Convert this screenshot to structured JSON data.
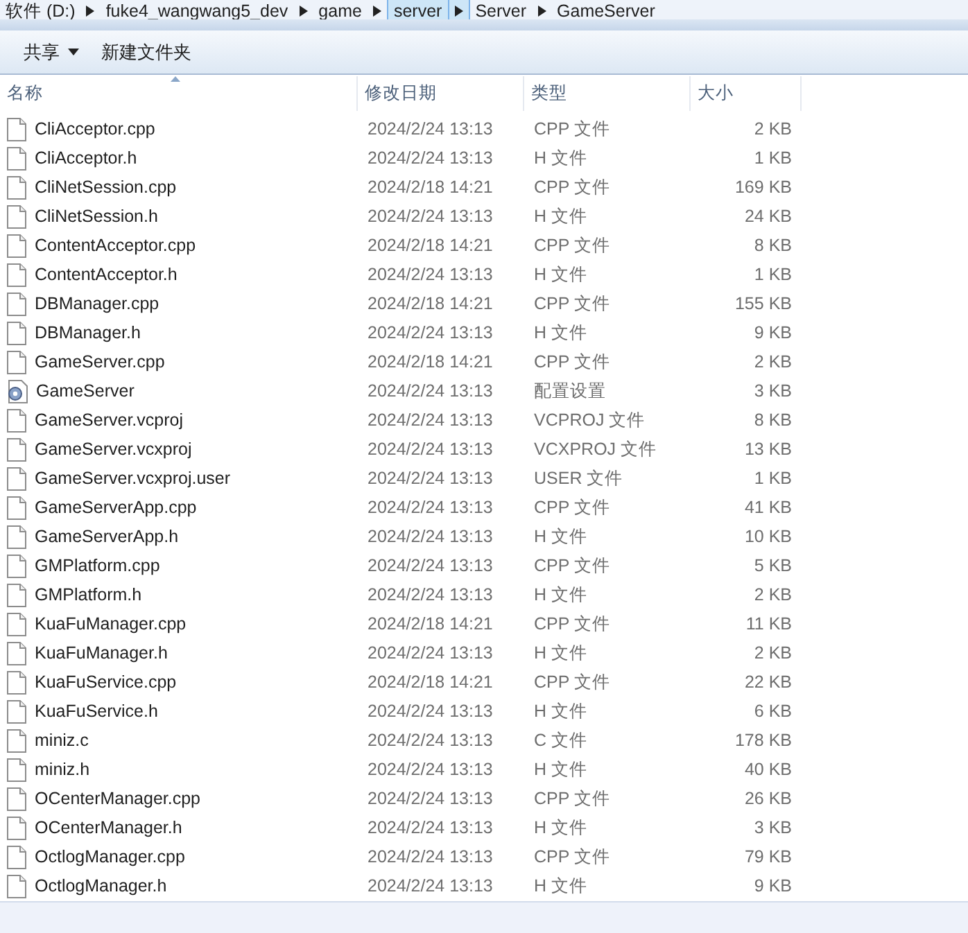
{
  "breadcrumb": [
    {
      "label": "软件 (D:)",
      "selected": false
    },
    {
      "label": "fuke4_wangwang5_dev",
      "selected": false
    },
    {
      "label": "game",
      "selected": false
    },
    {
      "label": "server",
      "selected": true
    },
    {
      "label": "Server",
      "selected": false
    },
    {
      "label": "GameServer",
      "selected": false
    }
  ],
  "toolbar": [
    {
      "label": "共享",
      "dropdown": true
    },
    {
      "label": "新建文件夹",
      "dropdown": false
    }
  ],
  "columns": [
    {
      "label": "名称",
      "sorted": true
    },
    {
      "label": "修改日期",
      "sorted": false
    },
    {
      "label": "类型",
      "sorted": false
    },
    {
      "label": "大小",
      "sorted": false
    }
  ],
  "rows": [
    {
      "kind": "file",
      "name": "CliAcceptor.cpp",
      "date": "2024/2/24 13:13",
      "type": "CPP 文件",
      "size": "2 KB"
    },
    {
      "kind": "file",
      "name": "CliAcceptor.h",
      "date": "2024/2/24 13:13",
      "type": "H 文件",
      "size": "1 KB"
    },
    {
      "kind": "file",
      "name": "CliNetSession.cpp",
      "date": "2024/2/18 14:21",
      "type": "CPP 文件",
      "size": "169 KB"
    },
    {
      "kind": "file",
      "name": "CliNetSession.h",
      "date": "2024/2/24 13:13",
      "type": "H 文件",
      "size": "24 KB"
    },
    {
      "kind": "file",
      "name": "ContentAcceptor.cpp",
      "date": "2024/2/18 14:21",
      "type": "CPP 文件",
      "size": "8 KB"
    },
    {
      "kind": "file",
      "name": "ContentAcceptor.h",
      "date": "2024/2/24 13:13",
      "type": "H 文件",
      "size": "1 KB"
    },
    {
      "kind": "file",
      "name": "DBManager.cpp",
      "date": "2024/2/18 14:21",
      "type": "CPP 文件",
      "size": "155 KB"
    },
    {
      "kind": "file",
      "name": "DBManager.h",
      "date": "2024/2/24 13:13",
      "type": "H 文件",
      "size": "9 KB"
    },
    {
      "kind": "file",
      "name": "GameServer.cpp",
      "date": "2024/2/18 14:21",
      "type": "CPP 文件",
      "size": "2 KB"
    },
    {
      "kind": "config",
      "name": "GameServer",
      "date": "2024/2/24 13:13",
      "type": "配置设置",
      "size": "3 KB"
    },
    {
      "kind": "file",
      "name": "GameServer.vcproj",
      "date": "2024/2/24 13:13",
      "type": "VCPROJ 文件",
      "size": "8 KB"
    },
    {
      "kind": "file",
      "name": "GameServer.vcxproj",
      "date": "2024/2/24 13:13",
      "type": "VCXPROJ 文件",
      "size": "13 KB"
    },
    {
      "kind": "file",
      "name": "GameServer.vcxproj.user",
      "date": "2024/2/24 13:13",
      "type": "USER 文件",
      "size": "1 KB"
    },
    {
      "kind": "file",
      "name": "GameServerApp.cpp",
      "date": "2024/2/24 13:13",
      "type": "CPP 文件",
      "size": "41 KB"
    },
    {
      "kind": "file",
      "name": "GameServerApp.h",
      "date": "2024/2/24 13:13",
      "type": "H 文件",
      "size": "10 KB"
    },
    {
      "kind": "file",
      "name": "GMPlatform.cpp",
      "date": "2024/2/24 13:13",
      "type": "CPP 文件",
      "size": "5 KB"
    },
    {
      "kind": "file",
      "name": "GMPlatform.h",
      "date": "2024/2/24 13:13",
      "type": "H 文件",
      "size": "2 KB"
    },
    {
      "kind": "file",
      "name": "KuaFuManager.cpp",
      "date": "2024/2/18 14:21",
      "type": "CPP 文件",
      "size": "11 KB"
    },
    {
      "kind": "file",
      "name": "KuaFuManager.h",
      "date": "2024/2/24 13:13",
      "type": "H 文件",
      "size": "2 KB"
    },
    {
      "kind": "file",
      "name": "KuaFuService.cpp",
      "date": "2024/2/18 14:21",
      "type": "CPP 文件",
      "size": "22 KB"
    },
    {
      "kind": "file",
      "name": "KuaFuService.h",
      "date": "2024/2/24 13:13",
      "type": "H 文件",
      "size": "6 KB"
    },
    {
      "kind": "file",
      "name": "miniz.c",
      "date": "2024/2/24 13:13",
      "type": "C 文件",
      "size": "178 KB"
    },
    {
      "kind": "file",
      "name": "miniz.h",
      "date": "2024/2/24 13:13",
      "type": "H 文件",
      "size": "40 KB"
    },
    {
      "kind": "file",
      "name": "OCenterManager.cpp",
      "date": "2024/2/24 13:13",
      "type": "CPP 文件",
      "size": "26 KB"
    },
    {
      "kind": "file",
      "name": "OCenterManager.h",
      "date": "2024/2/24 13:13",
      "type": "H 文件",
      "size": "3 KB"
    },
    {
      "kind": "file",
      "name": "OctlogManager.cpp",
      "date": "2024/2/24 13:13",
      "type": "CPP 文件",
      "size": "79 KB"
    },
    {
      "kind": "file",
      "name": "OctlogManager.h",
      "date": "2024/2/24 13:13",
      "type": "H 文件",
      "size": "9 KB"
    }
  ]
}
